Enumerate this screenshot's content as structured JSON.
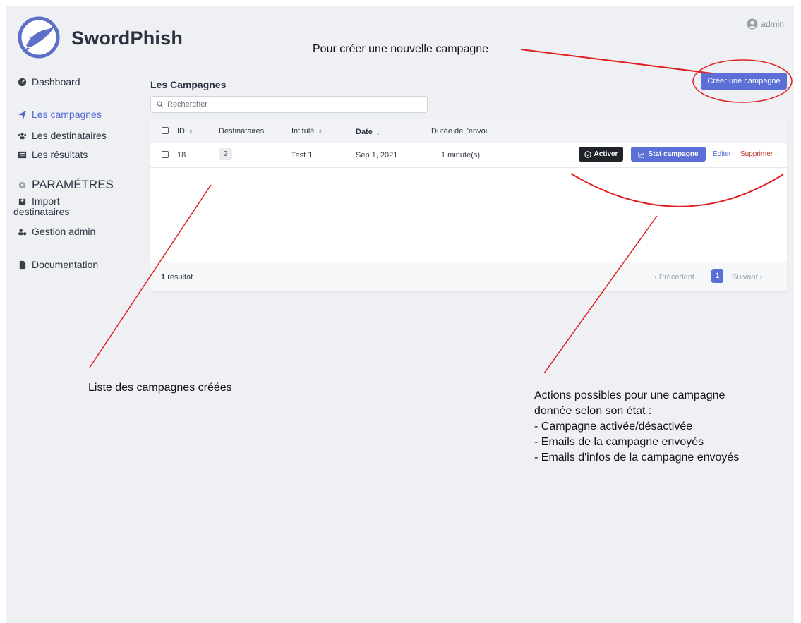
{
  "brand": {
    "name": "SwordPhish"
  },
  "user": {
    "label": "admin"
  },
  "sidebar": {
    "items": [
      {
        "label": "Dashboard",
        "icon": "dashboard-icon"
      },
      {
        "label": "Les campagnes",
        "icon": "paper-plane-icon",
        "active": true
      },
      {
        "label": "Les destinataires",
        "icon": "users-icon"
      },
      {
        "label": "Les résultats",
        "icon": "table-icon"
      },
      {
        "label": "PARAMÉTRES",
        "icon": "cog-icon"
      },
      {
        "label_line1": "Import",
        "label_line2": "destinataires",
        "icon": "import-icon"
      },
      {
        "label": "Gestion admin",
        "icon": "user-cog-icon"
      },
      {
        "label": "Documentation",
        "icon": "file-icon"
      }
    ]
  },
  "main": {
    "title": "Les Campagnes",
    "search_placeholder": "Rechercher",
    "create_button": "Créer une campagne",
    "table": {
      "headers": [
        "ID",
        "Destinataires",
        "Intitulé",
        "Date",
        "Durée de l'envoi"
      ],
      "rows": [
        {
          "id": "18",
          "destinataires": "2",
          "intitule": "Test 1",
          "date": "Sep 1, 2021",
          "duree": "1 minute(s)",
          "actions": {
            "activate": "Activer",
            "stats": "Stat campagne",
            "edit": "Éditer",
            "delete": "Supprimer"
          }
        }
      ],
      "footer": {
        "count": "1",
        "count_suffix": "résultat",
        "prev": "Précédent",
        "page": "1",
        "next": "Suivant"
      }
    }
  },
  "annotations": {
    "create_note": "Pour créer une nouvelle campagne",
    "list_note": "Liste des campagnes créées",
    "actions_lines": [
      "Actions possibles pour une campagne",
      "donnée selon son état :",
      "- Campagne activée/désactivée",
      "- Emails de la campagne envoyés",
      "- Emails d'infos de la campagne envoyés"
    ]
  },
  "colors": {
    "accent": "#5b6fd6",
    "background": "#eef0f4",
    "danger": "#c0392b",
    "dark_button": "#1f2329",
    "annotation": "#e02020"
  }
}
